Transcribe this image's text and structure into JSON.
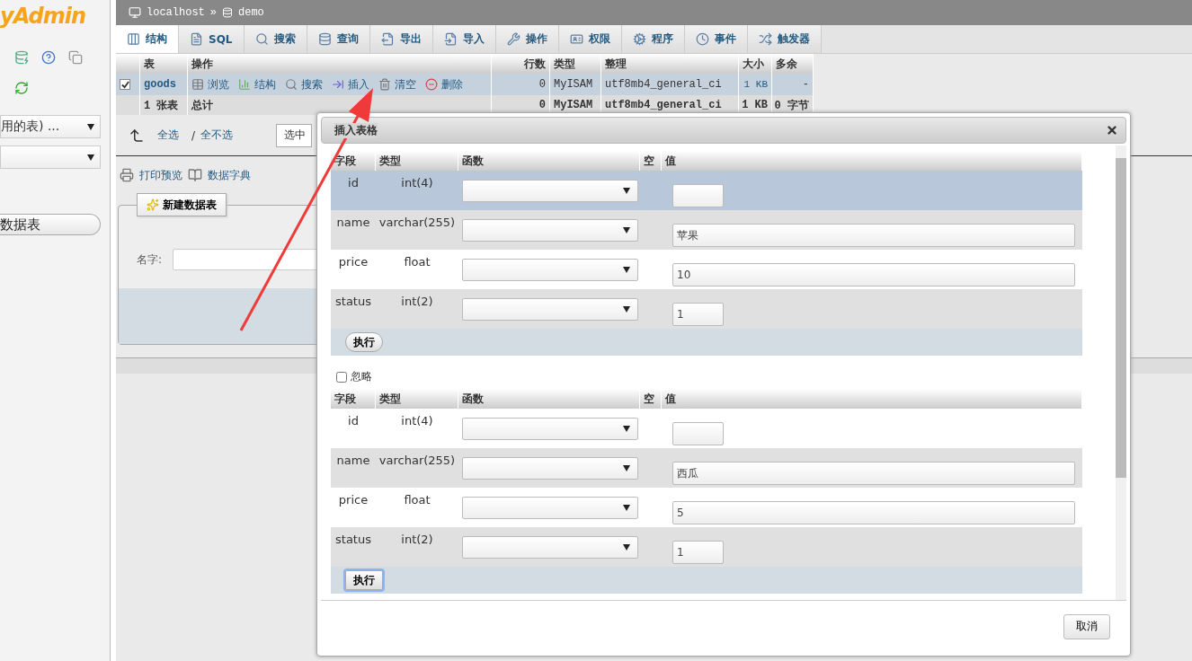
{
  "sidebar": {
    "logo": "yAdmin",
    "table_filter": "用的表) ...",
    "new_table_button": "数据表"
  },
  "breadcrumb": {
    "server": "localhost",
    "separator": "»",
    "database": "demo"
  },
  "tabs": [
    {
      "label": "结构",
      "selected": true
    },
    {
      "label": "SQL",
      "selected": false
    },
    {
      "label": "搜索",
      "selected": false
    },
    {
      "label": "查询",
      "selected": false
    },
    {
      "label": "导出",
      "selected": false
    },
    {
      "label": "导入",
      "selected": false
    },
    {
      "label": "操作",
      "selected": false
    },
    {
      "label": "权限",
      "selected": false
    },
    {
      "label": "程序",
      "selected": false
    },
    {
      "label": "事件",
      "selected": false
    },
    {
      "label": "触发器",
      "selected": false
    }
  ],
  "table": {
    "columns": [
      "表",
      "操作",
      "行数",
      "类型",
      "整理",
      "大小",
      "多余"
    ],
    "rows": [
      {
        "checked": true,
        "name": "goods",
        "actions": [
          "浏览",
          "结构",
          "搜索",
          "插入",
          "清空",
          "删除"
        ],
        "row_count": "0",
        "engine": "MyISAM",
        "collation": "utf8mb4_general_ci",
        "size": "1 KB",
        "overhead": "-"
      }
    ],
    "footer": {
      "count": "1 张表",
      "label": "总计",
      "row_count": "0",
      "engine": "MyISAM",
      "collation": "utf8mb4_general_ci",
      "size": "1 KB",
      "overhead": "0 字节"
    }
  },
  "selection": {
    "check_all": "全选",
    "separator": "/",
    "uncheck_all": "全不选",
    "with_selected": "选中"
  },
  "links": [
    "打印预览",
    "数据字典"
  ],
  "create_table": {
    "button": "新建数据表",
    "name_label": "名字:"
  },
  "dialog": {
    "title": "插入表格",
    "sections": [
      {
        "columns": [
          "字段",
          "类型",
          "函数",
          "空",
          "值"
        ],
        "rows": [
          {
            "field": "id",
            "type": "int(4)",
            "kind": "short",
            "highlighted": true
          },
          {
            "field": "name",
            "type": "varchar(255)",
            "value": "苹果",
            "kind": "long",
            "highlighted": false
          },
          {
            "field": "price",
            "type": "float",
            "value": "10",
            "kind": "long",
            "highlighted": false
          },
          {
            "field": "status",
            "type": "int(2)",
            "value": "1",
            "kind": "short",
            "highlighted": false
          }
        ],
        "execute": {
          "label": "执行",
          "focused": false
        }
      },
      {
        "ignore": {
          "label": "忽略",
          "checked": false
        },
        "columns": [
          "字段",
          "类型",
          "函数",
          "空",
          "值"
        ],
        "rows": [
          {
            "field": "id",
            "type": "int(4)",
            "kind": "short",
            "highlighted": false
          },
          {
            "field": "name",
            "type": "varchar(255)",
            "value": "西瓜",
            "kind": "long",
            "highlighted": false
          },
          {
            "field": "price",
            "type": "float",
            "value": "5",
            "kind": "long",
            "highlighted": false
          },
          {
            "field": "status",
            "type": "int(2)",
            "value": "1",
            "kind": "short",
            "highlighted": false
          }
        ],
        "execute": {
          "label": "执行",
          "focused": true
        }
      }
    ],
    "cancel": "取消"
  }
}
